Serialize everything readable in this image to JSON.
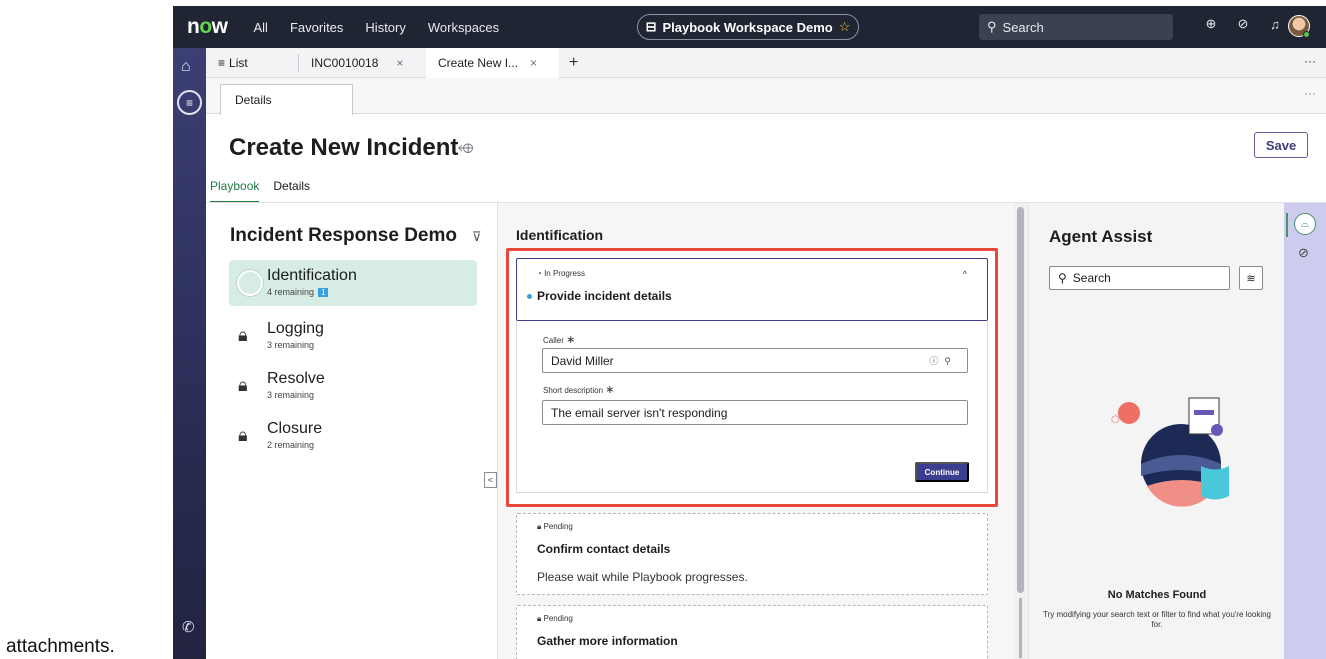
{
  "outer": {
    "bottom_text": "attachments."
  },
  "topbar": {
    "logo": "now",
    "nav": [
      "All",
      "Favorites",
      "History",
      "Workspaces"
    ],
    "workspace_pill": "Playbook Workspace Demo",
    "search_placeholder": "Search"
  },
  "tabs": {
    "list_label": "List",
    "incident_label": "INC0010018",
    "create_label": "Create New I...",
    "close_glyph": "×",
    "add_glyph": "+"
  },
  "subtab": {
    "label": "Details"
  },
  "header": {
    "title": "Create New Incident",
    "save_label": "Save",
    "tabs": [
      "Playbook",
      "Details"
    ]
  },
  "stages": {
    "title": "Incident Response Demo",
    "items": [
      {
        "name": "Identification",
        "remaining": "4 remaining",
        "badge": "1"
      },
      {
        "name": "Logging",
        "remaining": "3 remaining"
      },
      {
        "name": "Resolve",
        "remaining": "3 remaining"
      },
      {
        "name": "Closure",
        "remaining": "2 remaining"
      }
    ]
  },
  "playbook": {
    "section_title": "Identification",
    "active_task": {
      "status": "In Progress",
      "title": "Provide incident details",
      "caller_label": "Caller",
      "caller_value": "David Miller",
      "short_desc_label": "Short description",
      "short_desc_value": "The email server isn't responding",
      "continue_label": "Continue"
    },
    "pending": [
      {
        "status": "Pending",
        "title": "Confirm contact details",
        "message": "Please wait while Playbook progresses."
      },
      {
        "status": "Pending",
        "title": "Gather more information"
      }
    ]
  },
  "assist": {
    "title": "Agent Assist",
    "search_placeholder": "Search",
    "no_match_title": "No Matches Found",
    "no_match_text": "Try modifying your search text or filter to find what you're looking for."
  }
}
